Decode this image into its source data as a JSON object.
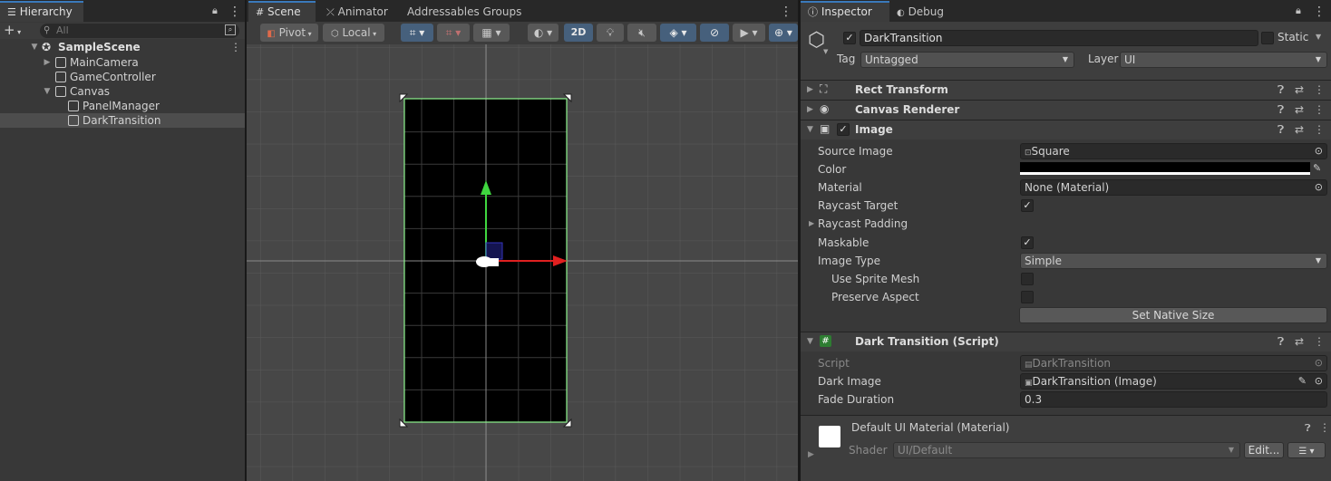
{
  "hierarchy": {
    "tab_label": "Hierarchy",
    "search_placeholder": "All",
    "add_label": "+",
    "scene_name": "SampleScene",
    "items": [
      {
        "label": "MainCamera"
      },
      {
        "label": "GameController"
      },
      {
        "label": "Canvas"
      },
      {
        "label": "PanelManager"
      },
      {
        "label": "DarkTransition"
      }
    ]
  },
  "scene": {
    "tabs": [
      {
        "label": "Scene"
      },
      {
        "label": "Animator"
      },
      {
        "label": "Addressables Groups"
      }
    ],
    "toolbar": {
      "pivot_label": "Pivot",
      "local_label": "Local",
      "mode_2d_label": "2D"
    }
  },
  "inspector": {
    "tabs": [
      {
        "label": "Inspector"
      },
      {
        "label": "Debug"
      }
    ],
    "object_name": "DarkTransition",
    "static_label": "Static",
    "tag_label": "Tag",
    "tag_value": "Untagged",
    "layer_label": "Layer",
    "layer_value": "UI",
    "components": {
      "rect_transform": "Rect Transform",
      "canvas_renderer": "Canvas Renderer",
      "image": "Image",
      "script": "Dark Transition (Script)"
    },
    "image": {
      "source_image_label": "Source Image",
      "source_image_value": "Square",
      "color_label": "Color",
      "color_value": "#000000",
      "material_label": "Material",
      "material_value": "None (Material)",
      "raycast_target_label": "Raycast Target",
      "raycast_padding_label": "Raycast Padding",
      "maskable_label": "Maskable",
      "image_type_label": "Image Type",
      "image_type_value": "Simple",
      "use_sprite_mesh_label": "Use Sprite Mesh",
      "preserve_aspect_label": "Preserve Aspect",
      "set_native_size_label": "Set Native Size"
    },
    "script": {
      "script_label": "Script",
      "script_value": "DarkTransition",
      "dark_image_label": "Dark Image",
      "dark_image_value": "DarkTransition (Image)",
      "fade_duration_label": "Fade Duration",
      "fade_duration_value": "0.3"
    },
    "material": {
      "title": "Default UI Material (Material)",
      "shader_label": "Shader",
      "shader_value": "UI/Default",
      "edit_label": "Edit..."
    }
  },
  "colors": {
    "accent": "#3a79bb",
    "selection_outline": "#8ef58e",
    "x_axis": "#e02020",
    "y_axis": "#3fd63f"
  }
}
